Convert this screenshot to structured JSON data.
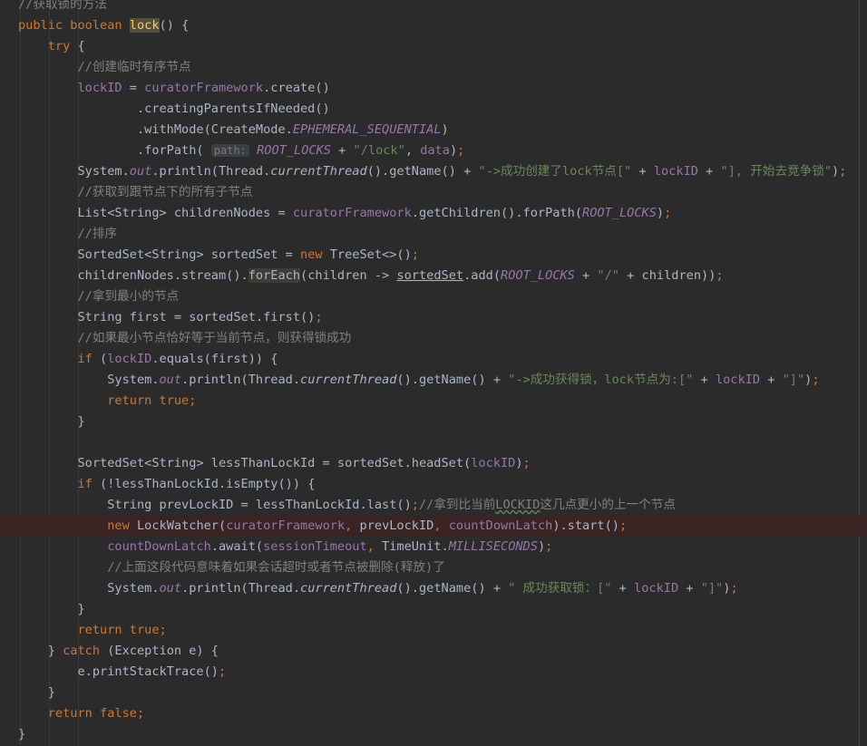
{
  "editor": {
    "lines": [
      [
        {
          "t": "//获取锁的方法",
          "c": "c"
        }
      ],
      [
        {
          "t": "public ",
          "c": "k"
        },
        {
          "t": "boolean ",
          "c": "k"
        },
        {
          "t": "lock",
          "c": "lockhl"
        },
        {
          "t": "() {"
        }
      ],
      [
        {
          "t": "    "
        },
        {
          "t": "try ",
          "c": "k"
        },
        {
          "t": "{"
        }
      ],
      [
        {
          "t": "        "
        },
        {
          "t": "//创建临时有序节点",
          "c": "c"
        }
      ],
      [
        {
          "t": "        "
        },
        {
          "t": "lockID",
          "c": "f"
        },
        {
          "t": " = "
        },
        {
          "t": "curatorFramework",
          "c": "f"
        },
        {
          "t": ".create()"
        }
      ],
      [
        {
          "t": "                .creatingParentsIfNeeded()"
        }
      ],
      [
        {
          "t": "                .withMode(CreateMode."
        },
        {
          "t": "EPHEMERAL_SEQUENTIAL",
          "c": "f i"
        },
        {
          "t": ")"
        }
      ],
      [
        {
          "t": "                .forPath( "
        },
        {
          "t": "path:",
          "c": "hint"
        },
        {
          "t": " "
        },
        {
          "t": "ROOT_LOCKS",
          "c": "f i"
        },
        {
          "t": " + "
        },
        {
          "t": "\"/lock\"",
          "c": "s"
        },
        {
          "t": ", "
        },
        {
          "t": "data",
          "c": "f"
        },
        {
          "t": ")"
        },
        {
          "t": ";",
          "c": "k"
        }
      ],
      [
        {
          "t": "        System."
        },
        {
          "t": "out",
          "c": "f i"
        },
        {
          "t": ".println(Thread."
        },
        {
          "t": "currentThread",
          "c": "i"
        },
        {
          "t": "().getName() + "
        },
        {
          "t": "\"->成功创建了lock节点[\"",
          "c": "s"
        },
        {
          "t": " + "
        },
        {
          "t": "lockID",
          "c": "f"
        },
        {
          "t": " + "
        },
        {
          "t": "\"], 开始去竞争锁\"",
          "c": "s"
        },
        {
          "t": ")"
        },
        {
          "t": ";",
          "c": "k"
        }
      ],
      [
        {
          "t": "        "
        },
        {
          "t": "//获取到跟节点下的所有子节点",
          "c": "c"
        }
      ],
      [
        {
          "t": "        List<String> childrenNodes = "
        },
        {
          "t": "curatorFramework",
          "c": "f"
        },
        {
          "t": ".getChildren().forPath("
        },
        {
          "t": "ROOT_LOCKS",
          "c": "f i"
        },
        {
          "t": ")"
        },
        {
          "t": ";",
          "c": "k"
        }
      ],
      [
        {
          "t": "        "
        },
        {
          "t": "//排序",
          "c": "c"
        }
      ],
      [
        {
          "t": "        SortedSet<String> sortedSet = "
        },
        {
          "t": "new ",
          "c": "k"
        },
        {
          "t": "TreeSet<>()"
        },
        {
          "t": ";",
          "c": "k"
        }
      ],
      [
        {
          "t": "        childrenNodes.stream()."
        },
        {
          "t": "forEach",
          "c": "foreachhl"
        },
        {
          "t": "(children -> "
        },
        {
          "t": "sortedSet",
          "c": "u"
        },
        {
          "t": ".add("
        },
        {
          "t": "ROOT_LOCKS",
          "c": "f i"
        },
        {
          "t": " + "
        },
        {
          "t": "\"/\"",
          "c": "s"
        },
        {
          "t": " + children))"
        },
        {
          "t": ";",
          "c": "k"
        }
      ],
      [
        {
          "t": "        "
        },
        {
          "t": "//拿到最小的节点",
          "c": "c"
        }
      ],
      [
        {
          "t": "        String first = sortedSet.first()"
        },
        {
          "t": ";",
          "c": "k"
        }
      ],
      [
        {
          "t": "        "
        },
        {
          "t": "//如果最小节点恰好等于当前节点，则获得锁成功",
          "c": "c"
        }
      ],
      [
        {
          "t": "        "
        },
        {
          "t": "if ",
          "c": "k"
        },
        {
          "t": "("
        },
        {
          "t": "lockID",
          "c": "f"
        },
        {
          "t": ".equals(first)) {"
        }
      ],
      [
        {
          "t": "            System."
        },
        {
          "t": "out",
          "c": "f i"
        },
        {
          "t": ".println(Thread."
        },
        {
          "t": "currentThread",
          "c": "i"
        },
        {
          "t": "().getName() + "
        },
        {
          "t": "\"->成功获得锁，lock节点为:[\"",
          "c": "s"
        },
        {
          "t": " + "
        },
        {
          "t": "lockID",
          "c": "f"
        },
        {
          "t": " + "
        },
        {
          "t": "\"]\"",
          "c": "s"
        },
        {
          "t": ")"
        },
        {
          "t": ";",
          "c": "k"
        }
      ],
      [
        {
          "t": "            "
        },
        {
          "t": "return true",
          "c": "k"
        },
        {
          "t": ";",
          "c": "k"
        }
      ],
      [
        {
          "t": "        }"
        }
      ],
      [
        {
          "t": ""
        }
      ],
      [
        {
          "t": "        SortedSet<String> lessThanLockId = sortedSet.headSet("
        },
        {
          "t": "lockID",
          "c": "f"
        },
        {
          "t": ")"
        },
        {
          "t": ";",
          "c": "k"
        }
      ],
      [
        {
          "t": "        "
        },
        {
          "t": "if ",
          "c": "k"
        },
        {
          "t": "(!lessThanLockId.isEmpty()) {"
        }
      ],
      [
        {
          "t": "            String prevLockID = lessThanLockId.last()"
        },
        {
          "t": ";",
          "c": "k"
        },
        {
          "t": "//拿到比当前",
          "c": "c"
        },
        {
          "t": "LOCKID",
          "c": "c squig"
        },
        {
          "t": "这几点更小的上一个节点",
          "c": "c"
        }
      ],
      [
        {
          "t": "            "
        },
        {
          "t": "new ",
          "c": "k"
        },
        {
          "t": "LockWatcher("
        },
        {
          "t": "curatorFramework",
          "c": "f"
        },
        {
          "t": ", ",
          "c": "k"
        },
        {
          "t": "prevLockID"
        },
        {
          "t": ", ",
          "c": "k"
        },
        {
          "t": "countDownLatch",
          "c": "f"
        },
        {
          "t": ").start()"
        },
        {
          "t": ";",
          "c": "k"
        }
      ],
      [
        {
          "t": "            "
        },
        {
          "t": "countDownLatch",
          "c": "f"
        },
        {
          "t": ".await("
        },
        {
          "t": "sessionTimeout",
          "c": "f"
        },
        {
          "t": ", ",
          "c": "k"
        },
        {
          "t": "TimeUnit."
        },
        {
          "t": "MILLISECONDS",
          "c": "f i"
        },
        {
          "t": ")"
        },
        {
          "t": ";",
          "c": "k"
        }
      ],
      [
        {
          "t": "            "
        },
        {
          "t": "//上面这段代码意味着如果会话超时或者节点被删除(释放)了",
          "c": "c"
        }
      ],
      [
        {
          "t": "            System."
        },
        {
          "t": "out",
          "c": "f i"
        },
        {
          "t": ".println(Thread."
        },
        {
          "t": "currentThread",
          "c": "i"
        },
        {
          "t": "().getName() + "
        },
        {
          "t": "\" 成功获取锁：[\"",
          "c": "s"
        },
        {
          "t": " + "
        },
        {
          "t": "lockID",
          "c": "f"
        },
        {
          "t": " + "
        },
        {
          "t": "\"]\"",
          "c": "s"
        },
        {
          "t": ")"
        },
        {
          "t": ";",
          "c": "k"
        }
      ],
      [
        {
          "t": "        }"
        }
      ],
      [
        {
          "t": "        "
        },
        {
          "t": "return true",
          "c": "k"
        },
        {
          "t": ";",
          "c": "k"
        }
      ],
      [
        {
          "t": "    } "
        },
        {
          "t": "catch ",
          "c": "k"
        },
        {
          "t": "(Exception e) {"
        }
      ],
      [
        {
          "t": "        e.printStackTrace()"
        },
        {
          "t": ";",
          "c": "k"
        }
      ],
      [
        {
          "t": "    }"
        }
      ],
      [
        {
          "t": "    "
        },
        {
          "t": "return false",
          "c": "k"
        },
        {
          "t": ";",
          "c": "k"
        }
      ],
      [
        {
          "t": "}"
        }
      ]
    ],
    "highlight_line": 25
  }
}
